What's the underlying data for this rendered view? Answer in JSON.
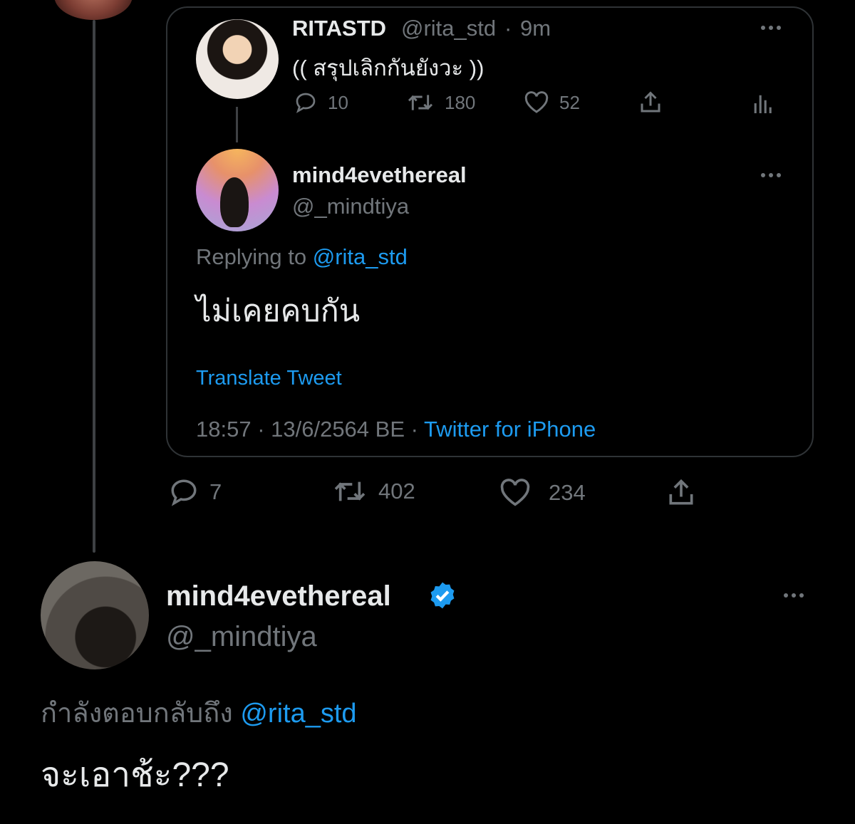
{
  "quoted_tweet": {
    "name": "RITASTD",
    "handle": "@rita_std",
    "separator": "·",
    "time": "9m",
    "text": "(( สรุปเลิกกันยังวะ ))",
    "actions": {
      "replies": "10",
      "retweets": "180",
      "likes": "52"
    }
  },
  "reply_tweet": {
    "name": "mind4evethereal",
    "handle": "@_mindtiya",
    "replying_prefix": "Replying to",
    "replying_mention": "@rita_std",
    "text": "ไม่เคยคบกัน",
    "translate": "Translate Tweet",
    "timestamp": "18:57 · 13/6/2564 BE ·",
    "via": "Twitter for iPhone"
  },
  "reply_actions": {
    "replies": "7",
    "retweets": "402",
    "likes": "234"
  },
  "main_tweet": {
    "name": "mind4evethereal",
    "handle": "@_mindtiya",
    "replying_prefix": "กำลังตอบกลับถึง",
    "replying_mention": "@rita_std",
    "text": "จะเอาช้ะ???"
  },
  "colors": {
    "background": "#000000",
    "link": "#1d9bf0",
    "muted": "#71767b",
    "text": "#e7e9ea",
    "verified": "#1d9bf0"
  },
  "icons": [
    "reply-icon",
    "retweet-icon",
    "like-icon",
    "share-icon",
    "analytics-icon",
    "more-icon",
    "verified-badge-icon"
  ]
}
